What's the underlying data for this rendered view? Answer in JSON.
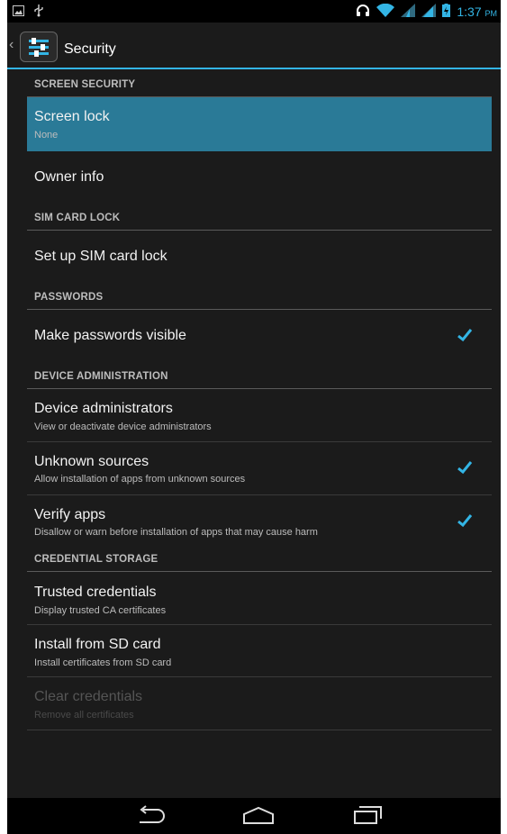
{
  "status_bar": {
    "time": "1:37",
    "ampm": "PM",
    "icons": [
      "image-icon",
      "usb-icon",
      "headset-icon",
      "wifi-icon",
      "signal-icon",
      "signal-icon",
      "battery-icon"
    ]
  },
  "action_bar": {
    "title": "Security",
    "icon": "settings-sliders-icon"
  },
  "sections": {
    "screen_security": "SCREEN SECURITY",
    "sim_card_lock": "SIM CARD LOCK",
    "passwords": "PASSWORDS",
    "device_administration": "DEVICE ADMINISTRATION",
    "credential_storage": "CREDENTIAL STORAGE"
  },
  "items": {
    "screen_lock": {
      "title": "Screen lock",
      "summary": "None"
    },
    "owner_info": {
      "title": "Owner info"
    },
    "sim_lock": {
      "title": "Set up SIM card lock"
    },
    "passwords_visible": {
      "title": "Make passwords visible",
      "checked": true
    },
    "device_admins": {
      "title": "Device administrators",
      "summary": "View or deactivate device administrators"
    },
    "unknown_sources": {
      "title": "Unknown sources",
      "summary": "Allow installation of apps from unknown sources",
      "checked": true
    },
    "verify_apps": {
      "title": "Verify apps",
      "summary": "Disallow or warn before installation of apps that may cause harm",
      "checked": true
    },
    "trusted_creds": {
      "title": "Trusted credentials",
      "summary": "Display trusted CA certificates"
    },
    "install_sd": {
      "title": "Install from SD card",
      "summary": "Install certificates from SD card"
    },
    "clear_creds": {
      "title": "Clear credentials",
      "summary": "Remove all certificates"
    }
  },
  "colors": {
    "accent": "#33b5e5",
    "selected": "#2a7a97",
    "background": "#1b1b1b"
  },
  "nav_bar": {
    "icons": [
      "back-icon",
      "home-icon",
      "recents-icon"
    ]
  }
}
